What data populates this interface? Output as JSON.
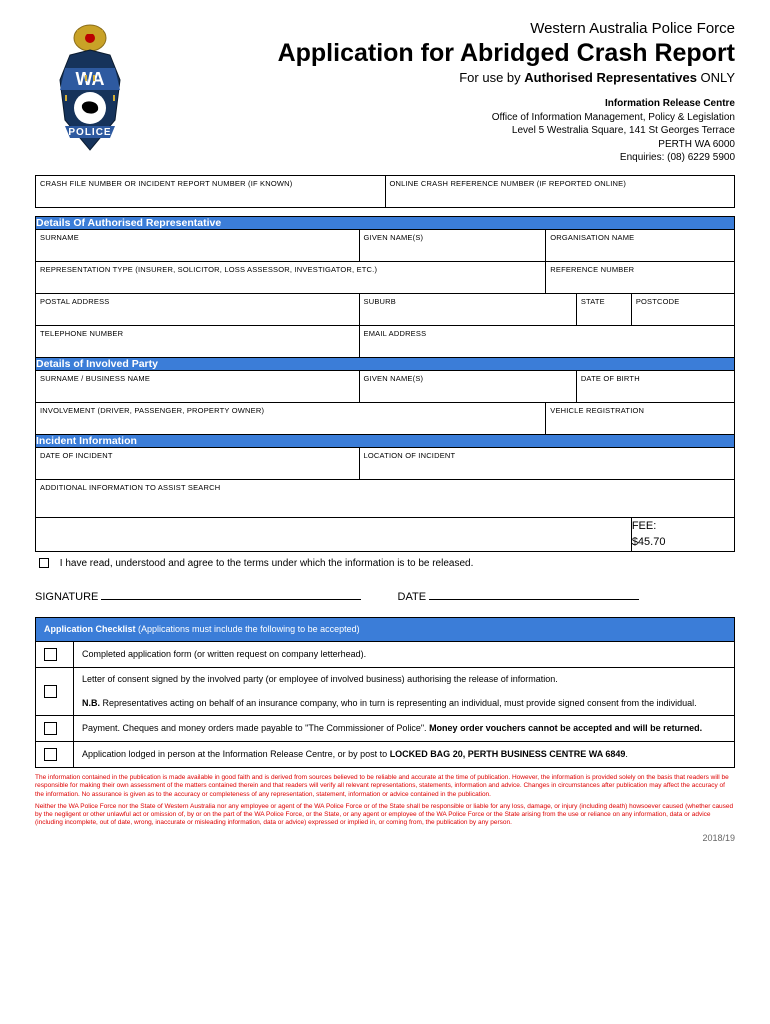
{
  "header": {
    "org": "Western Australia Police Force",
    "title": "Application for Abridged Crash Report",
    "subtitle_prefix": "For use by ",
    "subtitle_bold": "Authorised Representatives",
    "subtitle_suffix": " ONLY",
    "contact_title": "Information Release Centre",
    "contact_line1": "Office of Information Management, Policy & Legislation",
    "contact_line2": "Level 5 Westralia Square, 141 St Georges Terrace",
    "contact_line3": "PERTH WA 6000",
    "contact_line4": "Enquiries: (08) 6229 5900"
  },
  "top_fields": {
    "crash_file": "CRASH FILE NUMBER OR INCIDENT REPORT NUMBER (IF KNOWN)",
    "online_ref": "ONLINE CRASH REFERENCE NUMBER (IF REPORTED ONLINE)"
  },
  "sections": {
    "rep": {
      "title": "Details Of Authorised Representative",
      "surname": "SURNAME",
      "given": "GIVEN NAME(S)",
      "org": "ORGANISATION NAME",
      "rep_type": "REPRESENTATION TYPE (INSURER, SOLICITOR, LOSS ASSESSOR, INVESTIGATOR, ETC.)",
      "ref_num": "REFERENCE NUMBER",
      "postal": "POSTAL ADDRESS",
      "suburb": "SUBURB",
      "state": "STATE",
      "postcode": "POSTCODE",
      "phone": "TELEPHONE NUMBER",
      "email": "EMAIL ADDRESS"
    },
    "party": {
      "title": "Details of Involved Party",
      "surname": "SURNAME / BUSINESS NAME",
      "given": "GIVEN NAME(S)",
      "dob": "DATE OF BIRTH",
      "involvement": "INVOLVEMENT (DRIVER, PASSENGER, PROPERTY OWNER)",
      "vehicle": "VEHICLE REGISTRATION"
    },
    "incident": {
      "title": "Incident Information",
      "date": "DATE OF INCIDENT",
      "location": "LOCATION OF INCIDENT",
      "additional": "ADDITIONAL INFORMATION TO ASSIST SEARCH"
    }
  },
  "fee": {
    "label": "FEE:",
    "amount": "$45.70"
  },
  "agree": "I have read, understood and agree to the terms under which the information is to be released.",
  "signature": {
    "sig_label": "SIGNATURE",
    "date_label": "DATE"
  },
  "checklist": {
    "title": "Application Checklist",
    "title_paren": " (Applications must include the following to be accepted)",
    "items": [
      "Completed application form (or written request on company letterhead).",
      "Letter of consent signed by the involved party (or employee of involved business) authorising the release of information.",
      "N.B.",
      " Representatives acting on behalf of an insurance company, who in turn is representing an individual, must provide signed consent from the individual.",
      "Payment. Cheques and money orders made payable to \"The Commissioner of Police\". ",
      "Money order vouchers cannot be accepted and will be returned.",
      "Application lodged in person at the Information Release Centre, or by post to ",
      "LOCKED BAG 20, PERTH BUSINESS CENTRE WA 6849",
      "."
    ]
  },
  "disclaimer": {
    "p1": "The information contained in the publication is made available in good faith and is derived from sources believed to be reliable and accurate at the time of publication. However, the information is provided solely on the basis that readers will be responsible for making their own assessment of the matters contained therein and that readers will verify all relevant representations, statements, information and advice. Changes in circumstances after publication may affect the accuracy of the information. No assurance is given as to the accuracy or completeness of any representation, statement, information or advice contained in the publication.",
    "p2": "Neither the WA Police Force nor the State of Western Australia nor any employee or agent of the WA Police Force or of the State shall be responsible or liable for any loss, damage, or injury (including death) howsoever caused (whether caused by the negligent or other unlawful act or omission of, by or on the part of the WA Police Force, or the State, or any agent or employee of the WA Police Force or the State arising from the use or reliance on any information, data or advice (including incomplete, out of date, wrong, inaccurate or misleading information, data or advice) expressed or implied in, or coming from, the publication by any person."
  },
  "version": "2018/19",
  "badge_text": {
    "wa": "WA",
    "police": "POLICE"
  }
}
